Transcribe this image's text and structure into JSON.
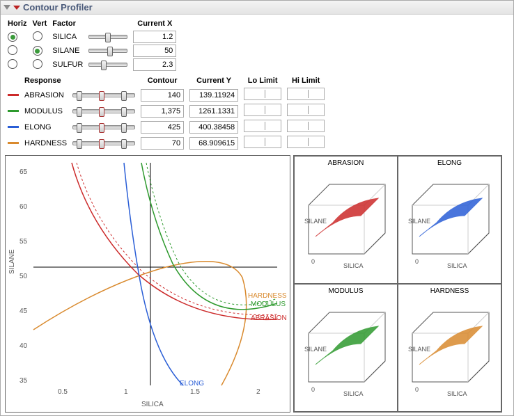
{
  "title": "Contour Profiler",
  "factorHeader": {
    "horiz": "Horiz",
    "vert": "Vert",
    "factor": "Factor",
    "curx": "Current X"
  },
  "factors": [
    {
      "name": "SILICA",
      "horiz": true,
      "vert": false,
      "slider_pos": 42,
      "current": "1.2"
    },
    {
      "name": "SILANE",
      "horiz": false,
      "vert": true,
      "slider_pos": 48,
      "current": "50"
    },
    {
      "name": "SULFUR",
      "horiz": false,
      "vert": false,
      "slider_pos": 30,
      "current": "2.3"
    }
  ],
  "respHeader": {
    "resp": "Response",
    "contour": "Contour",
    "cury": "Current Y",
    "lo": "Lo Limit",
    "hi": "Hi Limit"
  },
  "responses": [
    {
      "name": "ABRASION",
      "color": "#cc2a2a",
      "lo_pos": 5,
      "hi_pos": 78,
      "contour": "140",
      "cury": "139.11924"
    },
    {
      "name": "MODULUS",
      "color": "#2e9a2e",
      "lo_pos": 5,
      "hi_pos": 78,
      "contour": "1,375",
      "cury": "1261.1331"
    },
    {
      "name": "ELONG",
      "color": "#2a5ed6",
      "lo_pos": 5,
      "hi_pos": 78,
      "contour": "425",
      "cury": "400.38458"
    },
    {
      "name": "HARDNESS",
      "color": "#d98a2e",
      "lo_pos": 5,
      "hi_pos": 78,
      "contour": "70",
      "cury": "68.909615"
    }
  ],
  "chart": {
    "xlabel": "SILICA",
    "ylabel": "SILANE",
    "xticks": [
      "0.5",
      "1",
      "1.5",
      "2"
    ],
    "yticks": [
      "35",
      "40",
      "45",
      "50",
      "55",
      "60",
      "65"
    ],
    "crossX": 172,
    "crossY": 185,
    "annot": {
      "hardness": "HARDNESS",
      "modulus": "MODULUS",
      "abrasion": "ABRASION",
      "elong": "ELONG"
    }
  },
  "mini": {
    "labels": [
      "ABRASION",
      "ELONG",
      "MODULUS",
      "HARDNESS"
    ],
    "xlab": "SILICA",
    "ylab": "SILANE",
    "zero": "0",
    "colors": [
      "#cc2a2a",
      "#2a5ed6",
      "#2e9a2e",
      "#d98a2e"
    ]
  },
  "chart_data": {
    "type": "contour-profiler",
    "x_axis": "SILICA",
    "y_axis": "SILANE",
    "x_range": [
      0.3,
      2.1
    ],
    "y_range": [
      33,
      67
    ],
    "cross": {
      "SILICA": 1.2,
      "SILANE": 50
    },
    "contours": [
      {
        "response": "ABRASION",
        "level": 140
      },
      {
        "response": "MODULUS",
        "level": 1375
      },
      {
        "response": "ELONG",
        "level": 425
      },
      {
        "response": "HARDNESS",
        "level": 70
      }
    ],
    "surfaces": [
      {
        "response": "ABRASION",
        "axes": [
          "SILICA",
          "SILANE"
        ]
      },
      {
        "response": "ELONG",
        "axes": [
          "SILICA",
          "SILANE"
        ]
      },
      {
        "response": "MODULUS",
        "axes": [
          "SILICA",
          "SILANE"
        ]
      },
      {
        "response": "HARDNESS",
        "axes": [
          "SILICA",
          "SILANE"
        ]
      }
    ]
  }
}
